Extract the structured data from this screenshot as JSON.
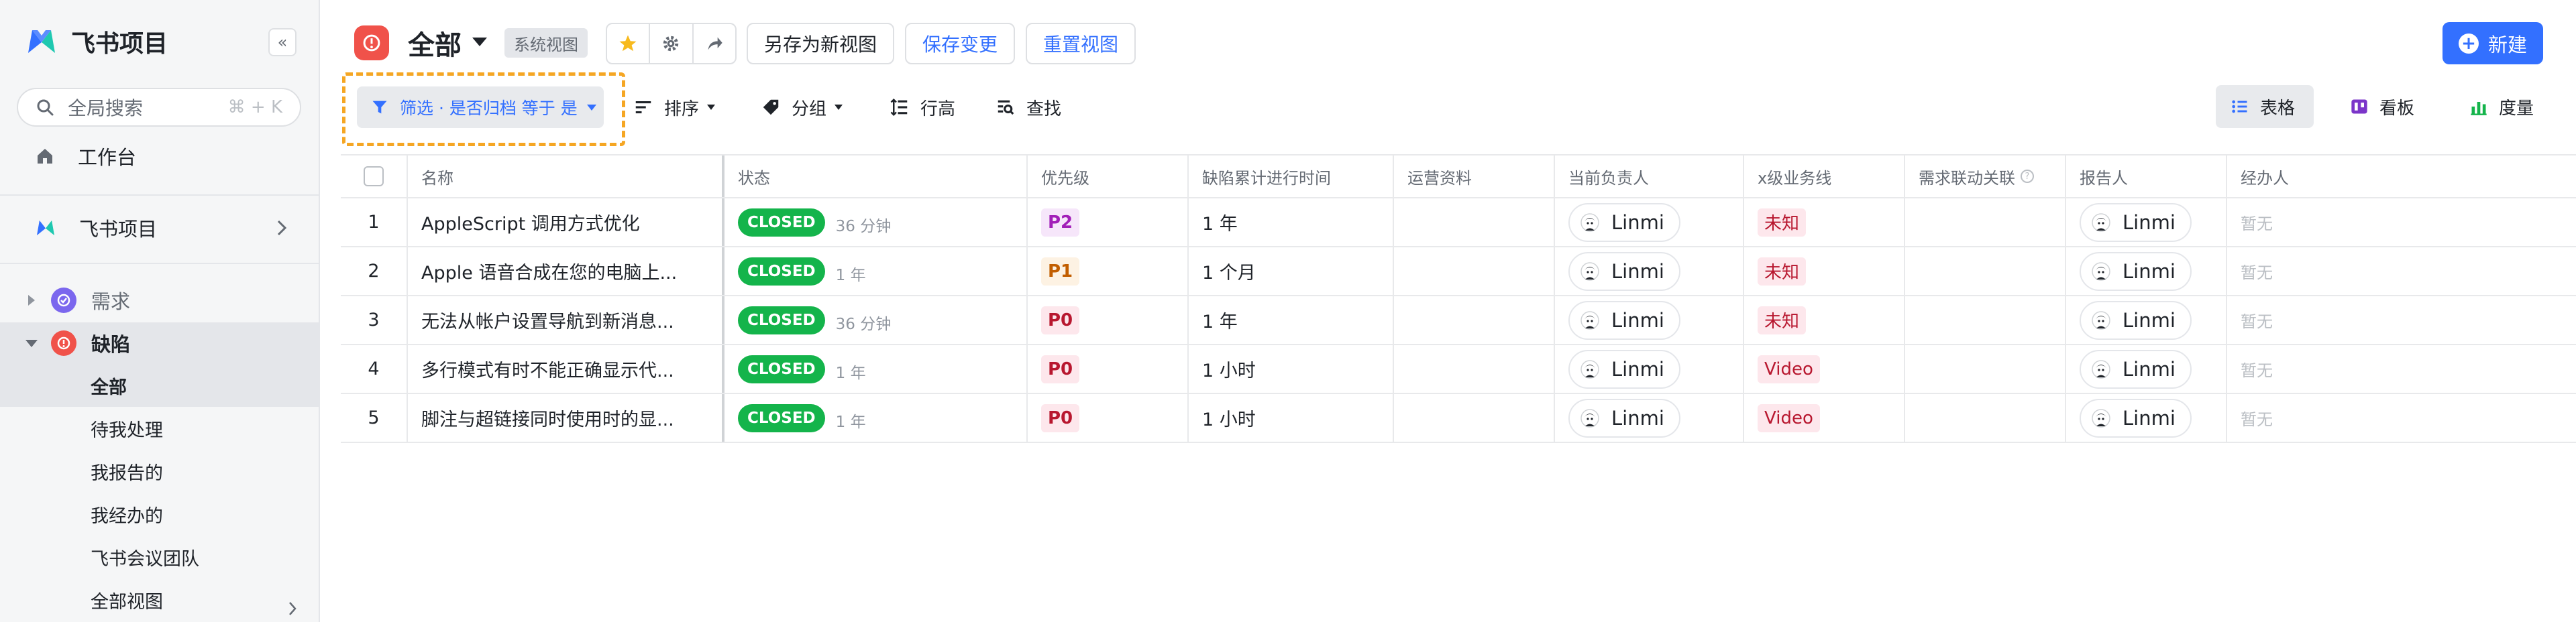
{
  "sidebar": {
    "app_title": "飞书项目",
    "search": {
      "label": "全局搜索",
      "shortcut": "⌘ + K"
    },
    "workbench": "工作台",
    "project": "飞书项目",
    "requirements": "需求",
    "defects": "缺陷",
    "sub_items": [
      "全部",
      "待我处理",
      "我报告的",
      "我经办的",
      "飞书会议团队",
      "全部视图"
    ]
  },
  "header": {
    "view_title": "全部",
    "system_tag": "系统视图",
    "save_as": "另存为新视图",
    "save_changes": "保存变更",
    "reset_view": "重置视图",
    "new_button": "新建"
  },
  "toolbar": {
    "filter": "筛选 · 是否归档 等于 是",
    "sort": "排序",
    "group": "分组",
    "row_height": "行高",
    "find": "查找",
    "views": {
      "table": "表格",
      "board": "看板",
      "metrics": "度量"
    }
  },
  "table": {
    "columns": {
      "name": "名称",
      "status": "状态",
      "priority": "优先级",
      "duration": "缺陷累计进行时间",
      "ops": "运营资料",
      "owner": "当前负责人",
      "biz": "x级业务线",
      "linked": "需求联动关联",
      "reporter": "报告人",
      "handler": "经办人"
    },
    "rows": [
      {
        "idx": "1",
        "name": "AppleScript 调用方式优化",
        "status": "CLOSED",
        "status_time": "36 分钟",
        "priority": "P2",
        "duration": "1 年",
        "owner": "Linmi",
        "biz": "未知",
        "reporter": "Linmi",
        "handler": "暂无"
      },
      {
        "idx": "2",
        "name": "Apple 语音合成在您的电脑上...",
        "status": "CLOSED",
        "status_time": "1 年",
        "priority": "P1",
        "duration": "1 个月",
        "owner": "Linmi",
        "biz": "未知",
        "reporter": "Linmi",
        "handler": "暂无"
      },
      {
        "idx": "3",
        "name": "无法从帐户设置导航到新消息...",
        "status": "CLOSED",
        "status_time": "36 分钟",
        "priority": "P0",
        "duration": "1 年",
        "owner": "Linmi",
        "biz": "未知",
        "reporter": "Linmi",
        "handler": "暂无"
      },
      {
        "idx": "4",
        "name": "多行模式有时不能正确显示代...",
        "status": "CLOSED",
        "status_time": "1 年",
        "priority": "P0",
        "duration": "1 小时",
        "owner": "Linmi",
        "biz": "Video",
        "reporter": "Linmi",
        "handler": "暂无"
      },
      {
        "idx": "5",
        "name": "脚注与超链接同时使用时的显...",
        "status": "CLOSED",
        "status_time": "1 年",
        "priority": "P0",
        "duration": "1 小时",
        "owner": "Linmi",
        "biz": "Video",
        "reporter": "Linmi",
        "handler": "暂无"
      }
    ]
  },
  "colors": {
    "accent": "#3370ff",
    "closed": "#14b44b",
    "defect_badge": "#f0524a",
    "requirement_badge": "#7b67ee",
    "highlight": "#f5a623",
    "priority": {
      "P2": {
        "bg": "#f6e6fa",
        "fg": "#a21fb8"
      },
      "P1": {
        "bg": "#fdf2e3",
        "fg": "#c25e00"
      },
      "P0": {
        "bg": "#fde7ec",
        "fg": "#b8172f"
      }
    }
  }
}
